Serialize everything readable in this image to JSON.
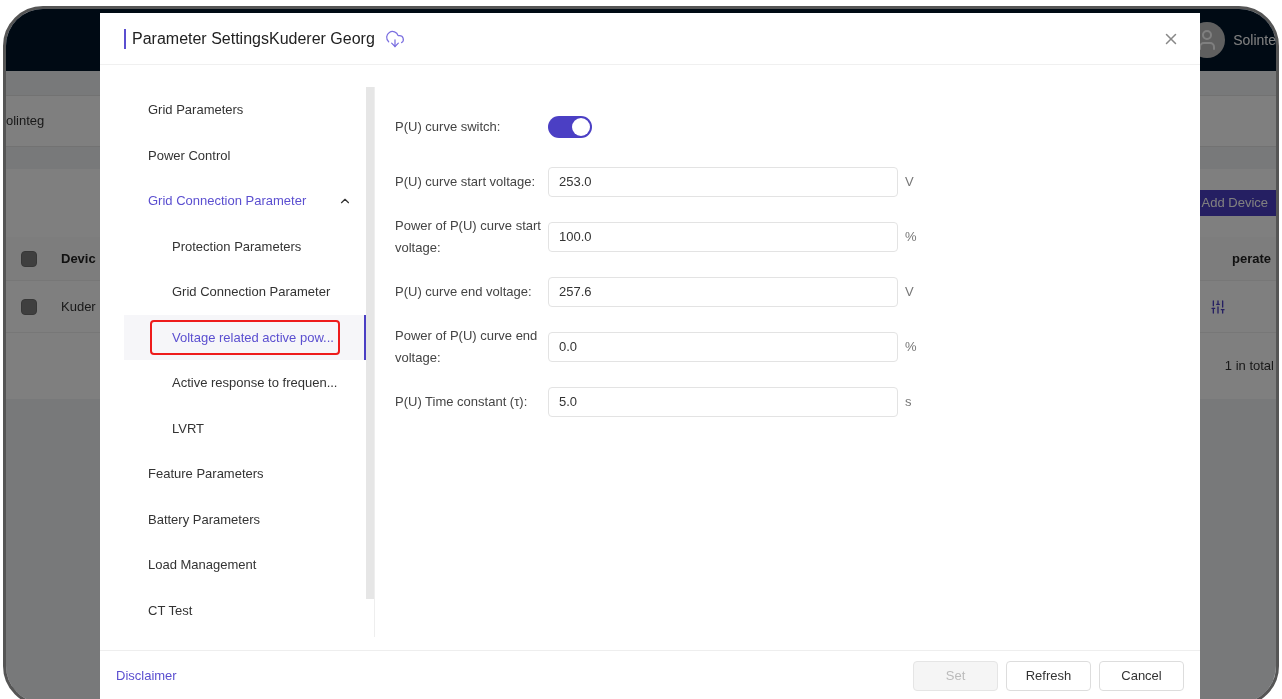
{
  "background": {
    "header": {
      "user_name": "Solinte"
    },
    "tab": "olinteg",
    "toolbar": {
      "add_button": "Add Device"
    },
    "table": {
      "columns": [
        {
          "label": "Devic"
        },
        {
          "label": "perate"
        }
      ],
      "rows": [
        {
          "cells": [
            "Kuder"
          ],
          "checked": false
        }
      ],
      "header_checked": false,
      "total": "1 in total"
    }
  },
  "dialog": {
    "title": "Parameter SettingsKuderer Georg",
    "nav": [
      {
        "label": "Grid Parameters",
        "selected": false
      },
      {
        "label": "Power Control",
        "selected": false
      },
      {
        "label": "Grid Connection Parameter",
        "selected": false,
        "expanded": true,
        "children": [
          {
            "label": "Protection Parameters",
            "selected": false,
            "highlight_box": false
          },
          {
            "label": "Grid Connection Parameter",
            "selected": false,
            "highlight_box": false
          },
          {
            "label": "Voltage related active pow...",
            "selected": true,
            "highlight_box": true
          },
          {
            "label": "Active response to frequen...",
            "selected": false,
            "highlight_box": false
          },
          {
            "label": "LVRT",
            "selected": false,
            "highlight_box": false
          }
        ]
      },
      {
        "label": "Feature Parameters",
        "selected": false
      },
      {
        "label": "Battery Parameters",
        "selected": false
      },
      {
        "label": "Load Management",
        "selected": false
      },
      {
        "label": "CT Test",
        "selected": false
      }
    ],
    "fields": [
      {
        "kind": "switch",
        "label": "P(U) curve switch:",
        "on": true
      },
      {
        "kind": "input",
        "label": "P(U) curve start voltage:",
        "value": "253.0",
        "unit": "V"
      },
      {
        "kind": "input",
        "label": "Power of P(U) curve start voltage:",
        "value": "100.0",
        "unit": "%"
      },
      {
        "kind": "input",
        "label": "P(U) curve end voltage:",
        "value": "257.6",
        "unit": "V"
      },
      {
        "kind": "input",
        "label": "Power of P(U) curve end voltage:",
        "value": "0.0",
        "unit": "%"
      },
      {
        "kind": "input",
        "label": "P(U) Time constant (τ):",
        "value": "5.0",
        "unit": "s"
      }
    ],
    "footer": {
      "link": "Disclaimer",
      "buttons": [
        {
          "label": "Set",
          "disabled": true
        },
        {
          "label": "Refresh",
          "disabled": false
        },
        {
          "label": "Cancel",
          "disabled": false
        }
      ]
    }
  }
}
